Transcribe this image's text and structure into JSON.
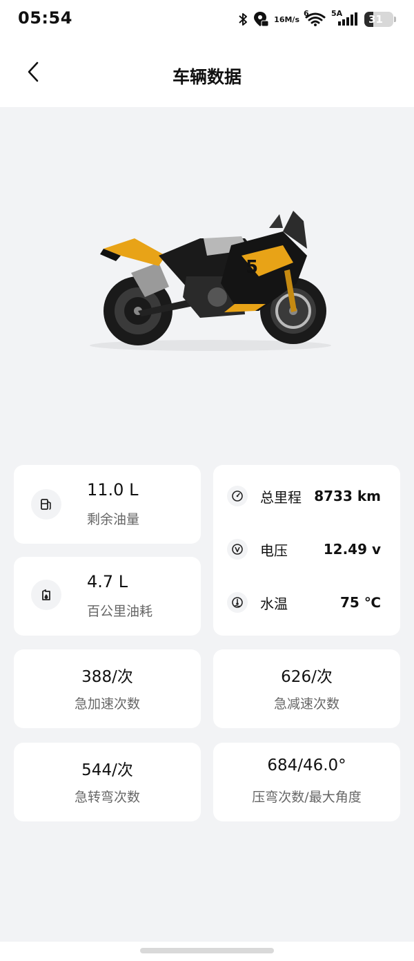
{
  "status_bar": {
    "time": "05:54",
    "net_speed_value": "16",
    "net_speed_unit": "M/s",
    "wifi_label": "6",
    "cellular_label": "5A",
    "battery_level": "31",
    "icons": [
      "bluetooth-icon",
      "location-icon",
      "wifi-icon",
      "signal-icon",
      "battery-icon"
    ]
  },
  "header": {
    "title": "车辆数据",
    "back_icon": "chevron-left-icon"
  },
  "hero": {
    "image_subject": "motorcycle",
    "colors": {
      "body": "#1a1a1a",
      "accent": "#e8a317"
    }
  },
  "fuel": [
    {
      "value": "11.0 L",
      "label": "剩余油量",
      "icon": "fuel-pump-icon"
    },
    {
      "value": "4.7 L",
      "label": "百公里油耗",
      "icon": "fuel-drop-icon"
    }
  ],
  "stats": [
    {
      "label": "总里程",
      "value": "8733 km",
      "icon": "speedometer-icon"
    },
    {
      "label": "电压",
      "value": "12.49 v",
      "icon": "voltage-icon"
    },
    {
      "label": "水温",
      "value": "75 ℃",
      "icon": "water-temp-icon"
    }
  ],
  "counts": [
    {
      "value": "388/次",
      "label": "急加速次数"
    },
    {
      "value": "626/次",
      "label": "急减速次数"
    },
    {
      "value": "544/次",
      "label": "急转弯次数"
    },
    {
      "value": "684/46.0°",
      "label": "压弯次数/最大角度"
    }
  ],
  "colors": {
    "background": "#f2f3f5",
    "card": "#ffffff",
    "text": "#111111",
    "muted": "#666666"
  }
}
